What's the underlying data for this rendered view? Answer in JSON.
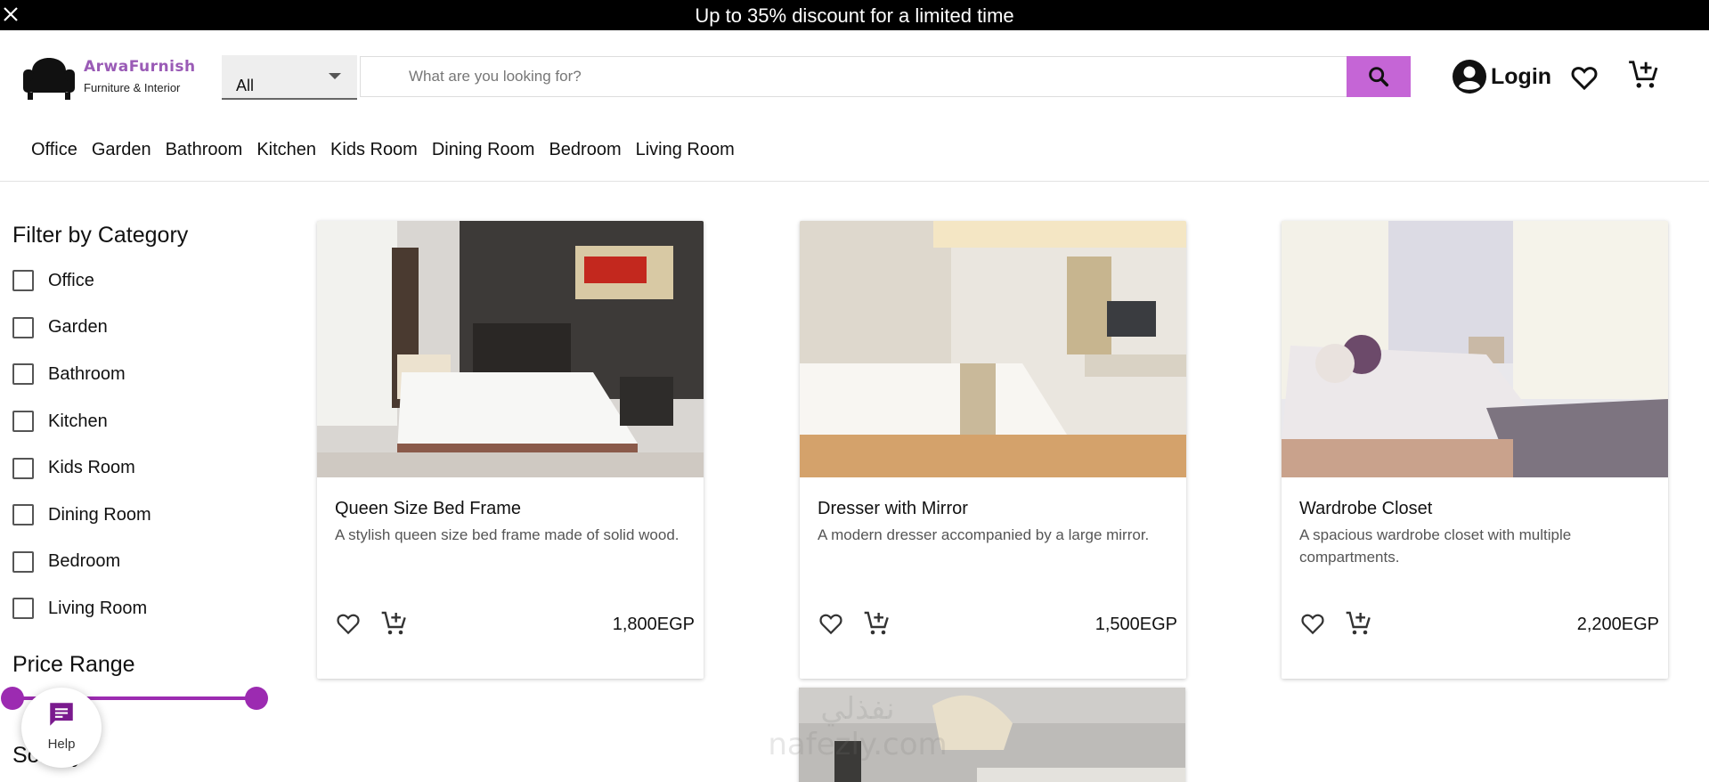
{
  "promo": {
    "text": "Up to 35% discount for a limited time"
  },
  "brand": {
    "name": "ArwaFurnish",
    "tagline": "Furniture & Interior"
  },
  "search": {
    "category_value": "All",
    "placeholder": "What are you looking for?"
  },
  "account": {
    "login_label": "Login"
  },
  "nav": [
    "Office",
    "Garden",
    "Bathroom",
    "Kitchen",
    "Kids Room",
    "Dining Room",
    "Bedroom",
    "Living Room"
  ],
  "filter": {
    "title": "Filter by Category",
    "categories": [
      "Office",
      "Garden",
      "Bathroom",
      "Kitchen",
      "Kids Room",
      "Dining Room",
      "Bedroom",
      "Living Room"
    ]
  },
  "price_range": {
    "title": "Price Range",
    "min_fraction": 0.0,
    "max_fraction": 1.0
  },
  "sort": {
    "title": "Sort by"
  },
  "help": {
    "label": "Help"
  },
  "products": [
    {
      "title": "Queen Size Bed Frame",
      "description": "A stylish queen size bed frame made of solid wood.",
      "price": "1,800EGP"
    },
    {
      "title": "Dresser with Mirror",
      "description": "A modern dresser accompanied by a large mirror.",
      "price": "1,500EGP"
    },
    {
      "title": "Wardrobe Closet",
      "description": "A spacious wardrobe closet with multiple compartments.",
      "price": "2,200EGP"
    }
  ],
  "watermark": {
    "arabic": "نفذلي",
    "latin": "nafezly.com"
  },
  "colors": {
    "accent": "#c565d6",
    "slider": "#9c2bb1",
    "brand": "#9a5bb6",
    "promo_bg": "#000000"
  },
  "icons": {
    "close": "close-icon",
    "logo": "armchair-icon",
    "search": "search-icon",
    "account": "account-circle-icon",
    "favorite": "heart-outline-icon",
    "cart": "add-shopping-cart-icon",
    "help": "chat-icon"
  }
}
